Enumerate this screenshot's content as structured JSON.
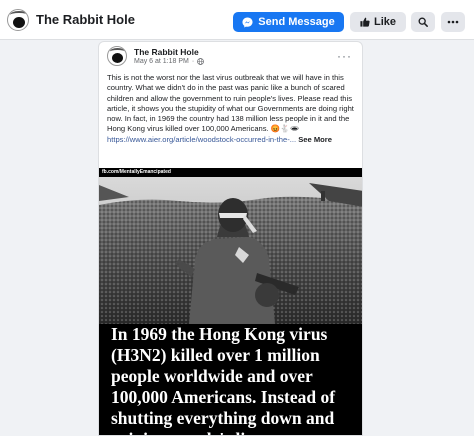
{
  "header": {
    "page_name": "The Rabbit Hole",
    "send_message_label": "Send Message",
    "like_label": "Like",
    "avatar_icon": "rabbit-hole-logo-icon",
    "icons": [
      "messenger-icon",
      "thumbs-up-icon",
      "search-icon",
      "more-icon"
    ]
  },
  "post": {
    "author": "The Rabbit Hole",
    "date": "May 6 at 1:18 PM",
    "dot_separator": "·",
    "privacy_icon": "globe-icon",
    "menu_icon": "more-dots-icon",
    "body": "This is not the worst nor the last virus outbreak that we will have in this country. What we didn't do in the past was panic like a bunch of scared children and allow the government to ruin people's lives. Please read this article, it shows you the stupidity of what our Governments are doing right now. In fact, in 1969 the country had 138 million less people in it and the Hong Kong virus killed over 100,000 Americans. 😡🐇🕳",
    "link": "https://www.aier.org/article/woodstock-occurred-in-the-...",
    "see_more": "See More"
  },
  "image": {
    "watermark": "fb.com/MentallyEmancipated",
    "caption": "In 1969 the Hong Kong virus (H3N2) killed over 1 million people worldwide and over 100,000 Americans. Instead of shutting everything down and ruining people's lives"
  },
  "colors": {
    "brand_blue": "#1877f2",
    "button_grey": "#e4e6eb",
    "link_blue": "#385898"
  }
}
